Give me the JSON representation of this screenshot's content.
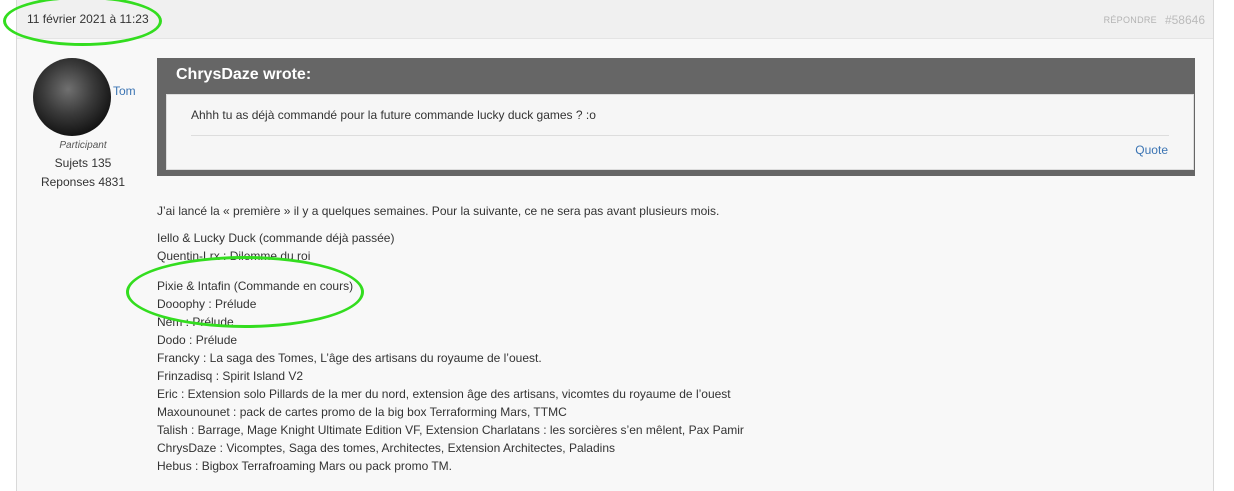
{
  "post": {
    "date": "11 février 2021 à 11:23",
    "reply_label": "Répondre",
    "post_id": "#58646"
  },
  "author": {
    "name": "Tom",
    "role": "Participant",
    "topics": "Sujets 135",
    "replies": "Reponses 4831"
  },
  "quote": {
    "title": "ChrysDaze wrote:",
    "text": "Ahhh tu as déjà commandé pour la future commande lucky duck games ? :o",
    "link_label": "Quote"
  },
  "content": {
    "intro": "J’ai lancé la « première » il y a quelques semaines. Pour la suivante, ce ne sera pas avant plusieurs mois.",
    "group1": [
      "Iello & Lucky Duck (commande déjà passée)",
      "Quentin-Lrx : Dilemme du roi"
    ],
    "group2": [
      "Pixie & Intafin (Commande en cours)",
      "Dooophy : Prélude",
      "Nem : Prélude",
      "Dodo : Prélude",
      "Francky : La saga des Tomes, L’âge des artisans du royaume de l’ouest.",
      "Frinzadisq : Spirit Island V2",
      "Eric : Extension solo Pillards de la mer du nord, extension âge des artisans, vicomtes du royaume de l’ouest",
      "Maxounounet : pack de cartes promo de la big box Terraforming Mars, TTMC",
      "Talish : Barrage, Mage Knight Ultimate Edition VF, Extension Charlatans : les sorcières s’en mêlent, Pax Pamir",
      "ChrysDaze : Vicomptes, Saga des tomes, Architectes, Extension Architectes, Paladins",
      "Hebus : Bigbox Terrafroaming Mars ou pack promo TM."
    ]
  },
  "colors": {
    "link": "#3b74b3",
    "quote_header": "#666666",
    "annotation": "#33dd1f"
  }
}
